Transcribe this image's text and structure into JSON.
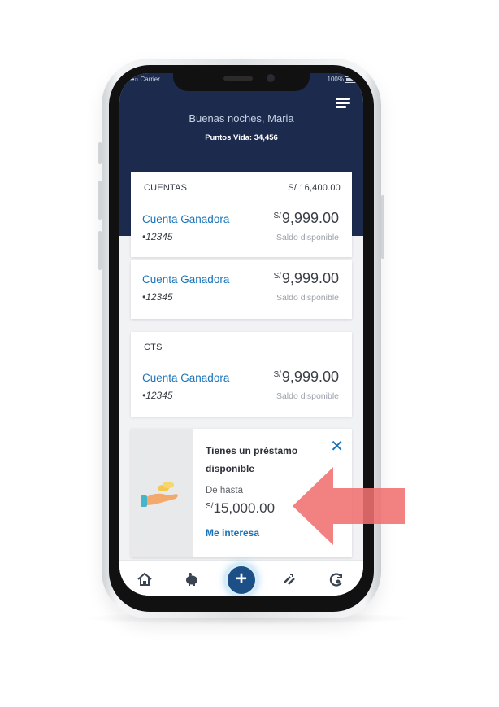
{
  "status_bar": {
    "carrier": "Carrier",
    "battery": "100%"
  },
  "header": {
    "greeting": "Buenas noches, Maria",
    "points": "Puntos Vida: 34,456"
  },
  "cuentas": {
    "title": "CUENTAS",
    "total": "S/ 16,400.00",
    "accounts": [
      {
        "name": "Cuenta Ganadora",
        "number": "•12345",
        "currency": "S/",
        "amount": "9,999.00",
        "label": "Saldo disponible"
      },
      {
        "name": "Cuenta Ganadora",
        "number": "•12345",
        "currency": "S/",
        "amount": "9,999.00",
        "label": "Saldo disponible"
      }
    ]
  },
  "cts": {
    "title": "CTS",
    "accounts": [
      {
        "name": "Cuenta Ganadora",
        "number": "•12345",
        "currency": "S/",
        "amount": "9,999.00",
        "label": "Saldo disponible"
      }
    ]
  },
  "loan": {
    "title": "Tienes un préstamo disponible",
    "from": "De hasta",
    "currency": "S/",
    "amount": "15,000.00",
    "cta": "Me interesa"
  },
  "bottom_nav": {
    "items": [
      "home-icon",
      "piggy-bank-icon",
      "plus-icon",
      "transfer-icon",
      "refresh-icon"
    ],
    "fab_label": "+"
  },
  "colors": {
    "header": "#1c2a4e",
    "link": "#1a73b8",
    "fab": "#1c4f86",
    "annotation_arrow": "#f07070"
  }
}
